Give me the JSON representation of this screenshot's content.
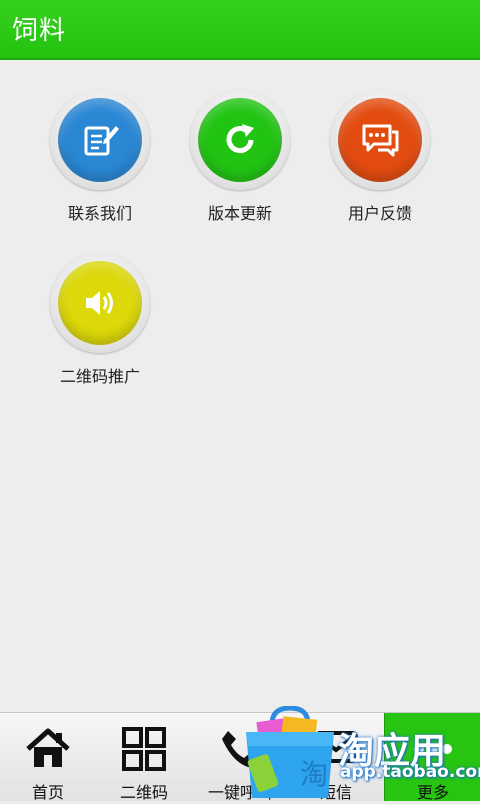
{
  "header": {
    "title": "饲料"
  },
  "grid": {
    "items": [
      {
        "label": "联系我们",
        "icon": "contact-edit-icon",
        "color": "#2a87d4"
      },
      {
        "label": "版本更新",
        "icon": "refresh-icon",
        "color": "#22c414"
      },
      {
        "label": "用户反馈",
        "icon": "chat-bubbles-icon",
        "color": "#e34c10"
      },
      {
        "label": "二维码推广",
        "icon": "speaker-icon",
        "color": "#dcd80a"
      }
    ]
  },
  "tabbar": {
    "tabs": [
      {
        "label": "首页",
        "icon": "home-icon"
      },
      {
        "label": "二维码",
        "icon": "qr-code-icon"
      },
      {
        "label": "一键呼叫",
        "icon": "phone-icon"
      },
      {
        "label": "短信",
        "icon": "message-icon"
      },
      {
        "label": "更多",
        "icon": "more-icon",
        "active": true
      }
    ]
  },
  "watermark": {
    "title": "淘应用",
    "url": "app.taobao.com"
  },
  "colors": {
    "header": "#24c20f",
    "active_tab": "#28c412"
  }
}
